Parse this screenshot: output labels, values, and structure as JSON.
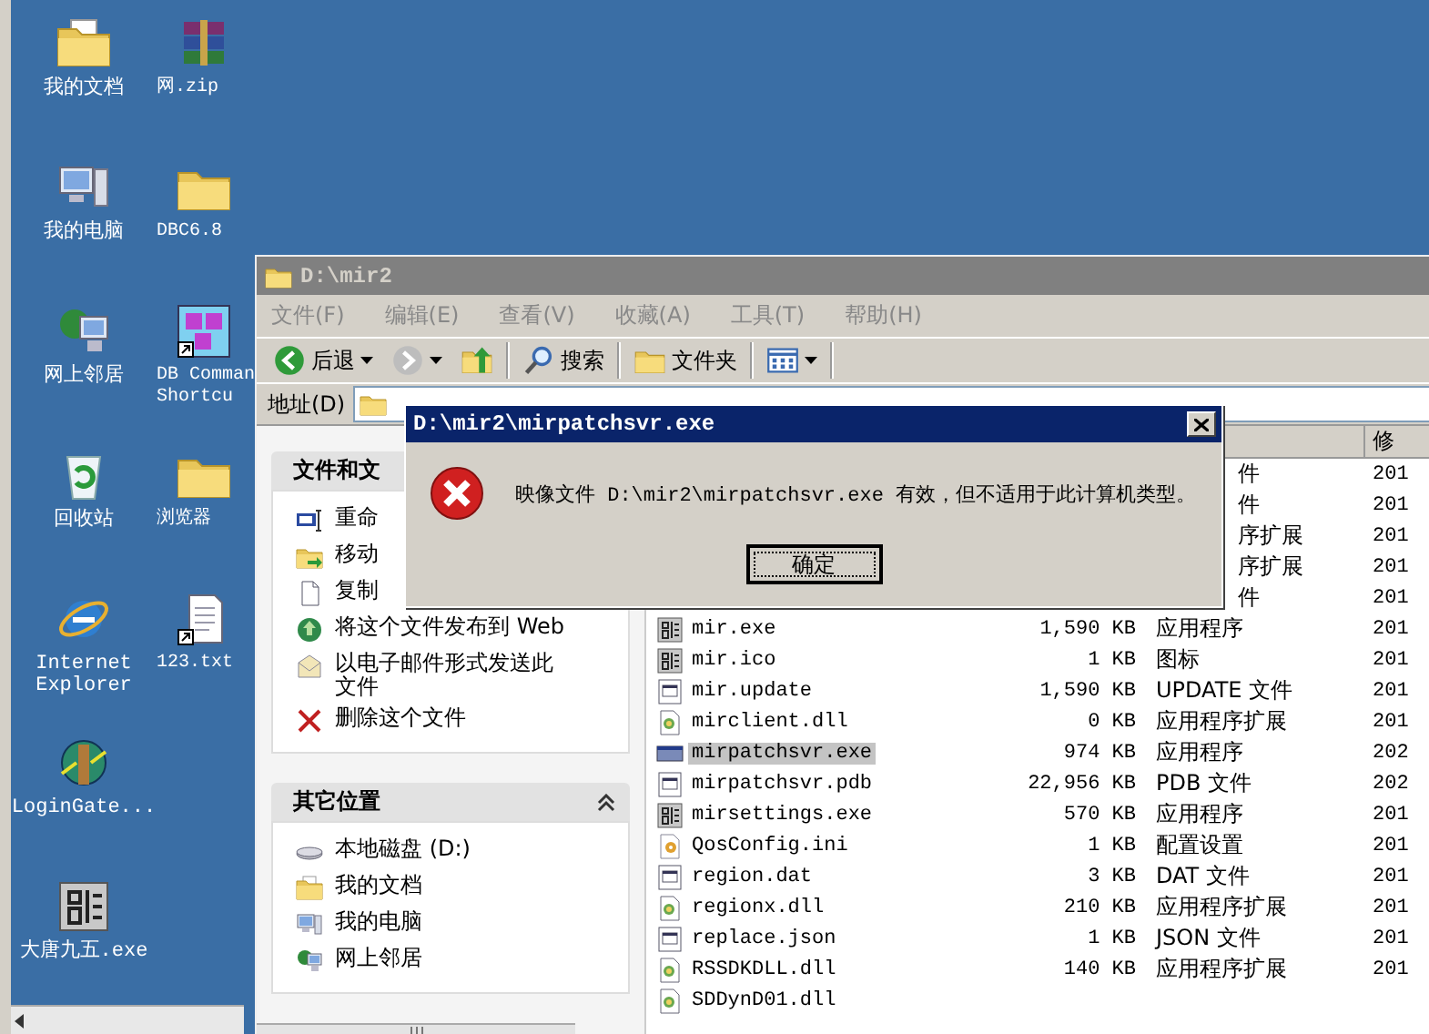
{
  "desktop": {
    "columns": [
      [
        {
          "kind": "documents",
          "label": "我的文档"
        },
        {
          "kind": "computer",
          "label": "我的电脑"
        },
        {
          "kind": "network",
          "label": "网上邻居"
        },
        {
          "kind": "recycle",
          "label": "回收站"
        },
        {
          "kind": "browser",
          "label": "Internet\nExplorer"
        },
        {
          "kind": "gate",
          "label": "LoginGate..."
        },
        {
          "kind": "dragon",
          "label": "大唐九五.exe"
        }
      ],
      [
        {
          "kind": "zip",
          "label": "网.zip"
        },
        {
          "kind": "folder",
          "label": "DBC6.8"
        },
        {
          "kind": "dbc",
          "label": "DB Comman\nShortcu"
        },
        {
          "kind": "folder",
          "label": "浏览器"
        },
        {
          "kind": "txt",
          "label": "123.txt"
        }
      ]
    ]
  },
  "explorer": {
    "title": "D:\\mir2",
    "active": false,
    "menu": [
      {
        "label": "文件(F)"
      },
      {
        "label": "编辑(E)"
      },
      {
        "label": "查看(V)"
      },
      {
        "label": "收藏(A)"
      },
      {
        "label": "工具(T)"
      },
      {
        "label": "帮助(H)"
      }
    ],
    "toolbar": [
      {
        "kind": "back",
        "label": "后退"
      },
      {
        "kind": "forward"
      },
      {
        "kind": "up"
      },
      {
        "kind": "search",
        "label": "搜索"
      },
      {
        "kind": "folders",
        "label": "文件夹"
      },
      {
        "kind": "views"
      }
    ],
    "address": {
      "label": "地址(D)"
    },
    "tasks_panel": {
      "title": "文件和文",
      "items": [
        {
          "kind": "rename",
          "label": "重命"
        },
        {
          "kind": "move",
          "label": "移动"
        },
        {
          "kind": "copy",
          "label": "复制"
        },
        {
          "kind": "publish",
          "label": "将这个文件发布到 Web"
        },
        {
          "kind": "email",
          "label": "以电子邮件形式发送此文件"
        },
        {
          "kind": "delete",
          "label": "删除这个文件"
        }
      ]
    },
    "places_panel": {
      "title": "其它位置",
      "expanded": true,
      "items": [
        {
          "kind": "disk",
          "label": "本地磁盘 (D:)"
        },
        {
          "kind": "documents",
          "label": "我的文档"
        },
        {
          "kind": "computer",
          "label": "我的电脑"
        },
        {
          "kind": "network",
          "label": "网上邻居"
        }
      ]
    },
    "file_list": {
      "columns": [
        {
          "label": "修"
        }
      ],
      "rows": [
        {
          "kind": "covered",
          "type": "件",
          "date": "201"
        },
        {
          "kind": "covered",
          "type": "件",
          "date": "201"
        },
        {
          "kind": "covered",
          "type": "序扩展",
          "date": "201"
        },
        {
          "kind": "covered",
          "type": "序扩展",
          "date": "201"
        },
        {
          "kind": "covered",
          "type": "件",
          "date": "201"
        },
        {
          "kind": "dragon",
          "name": "mir.exe",
          "size": "1,590 KB",
          "type": "应用程序",
          "date": "201",
          "selected": false
        },
        {
          "kind": "dragon",
          "name": "mir.ico",
          "size": "1 KB",
          "type": "图标",
          "date": "201",
          "selected": false
        },
        {
          "kind": "doc",
          "name": "mir.update",
          "size": "1,590 KB",
          "type": "UPDATE 文件",
          "date": "201",
          "selected": false
        },
        {
          "kind": "dll",
          "name": "mirclient.dll",
          "size": "0 KB",
          "type": "应用程序扩展",
          "date": "201",
          "selected": false
        },
        {
          "kind": "program",
          "name": "mirpatchsvr.exe",
          "size": "974 KB",
          "type": "应用程序",
          "date": "202",
          "selected": true
        },
        {
          "kind": "doc",
          "name": "mirpatchsvr.pdb",
          "size": "22,956 KB",
          "type": "PDB 文件",
          "date": "202",
          "selected": false
        },
        {
          "kind": "dragon",
          "name": "mirsettings.exe",
          "size": "570 KB",
          "type": "应用程序",
          "date": "201",
          "selected": false
        },
        {
          "kind": "config",
          "name": "QosConfig.ini",
          "size": "1 KB",
          "type": "配置设置",
          "date": "201",
          "selected": false
        },
        {
          "kind": "doc",
          "name": "region.dat",
          "size": "3 KB",
          "type": "DAT 文件",
          "date": "201",
          "selected": false
        },
        {
          "kind": "dll",
          "name": "regionx.dll",
          "size": "210 KB",
          "type": "应用程序扩展",
          "date": "201",
          "selected": false
        },
        {
          "kind": "doc",
          "name": "replace.json",
          "size": "1 KB",
          "type": "JSON 文件",
          "date": "201",
          "selected": false
        },
        {
          "kind": "dll",
          "name": "RSSDKDLL.dll",
          "size": "140 KB",
          "type": "应用程序扩展",
          "date": "201",
          "selected": false
        },
        {
          "kind": "dll",
          "name": "SDDynD01.dll",
          "selected": false
        }
      ]
    }
  },
  "dialog": {
    "title": "D:\\mir2\\mirpatchsvr.exe",
    "message": "映像文件 D:\\mir2\\mirpatchsvr.exe 有效，但不适用于此计算机类型。",
    "button": "确定"
  }
}
